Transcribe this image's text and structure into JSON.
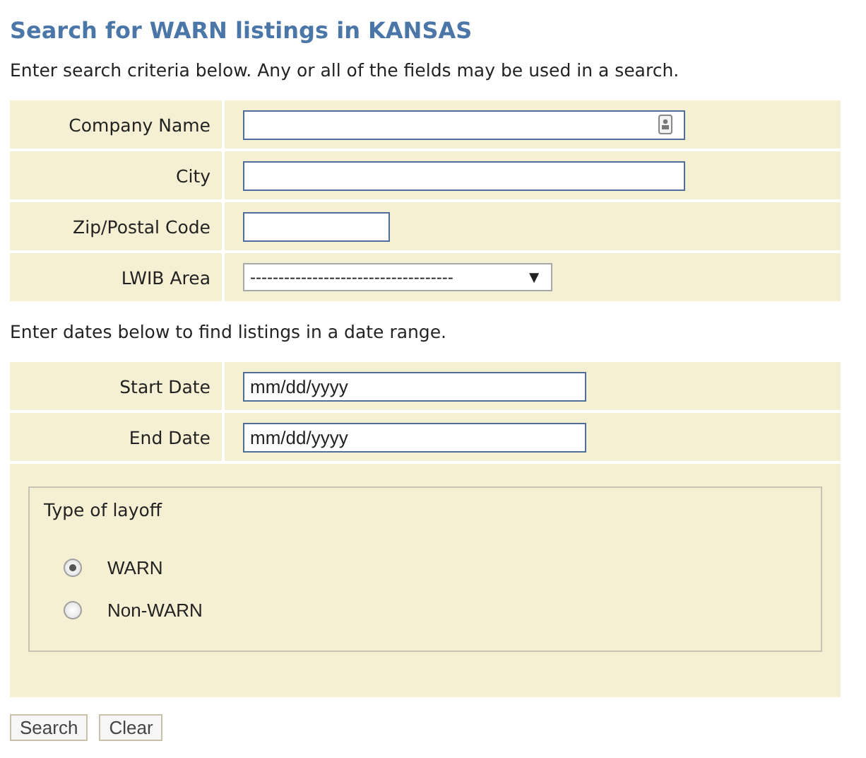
{
  "title": "Search for WARN listings in KANSAS",
  "intro": "Enter search criteria below. Any or all of the fields may be used in a search.",
  "criteria": [
    {
      "label": "Company Name",
      "kind": "contact"
    },
    {
      "label": "City",
      "kind": "wide"
    },
    {
      "label": "Zip/Postal Code",
      "kind": "short"
    },
    {
      "label": "LWIB Area",
      "kind": "select",
      "value": "------------------------------------",
      "arrow": "▼"
    }
  ],
  "dates_intro": "Enter dates below to find listings in a date range.",
  "dates": [
    {
      "label": "Start Date",
      "placeholder": "mm/dd/yyyy"
    },
    {
      "label": "End Date",
      "placeholder": "mm/dd/yyyy"
    }
  ],
  "layoff": {
    "legend": "Type of layoff",
    "options": [
      {
        "label": "WARN",
        "selected": true
      },
      {
        "label": "Non-WARN",
        "selected": false
      }
    ]
  },
  "buttons": [
    "Search",
    "Clear"
  ]
}
